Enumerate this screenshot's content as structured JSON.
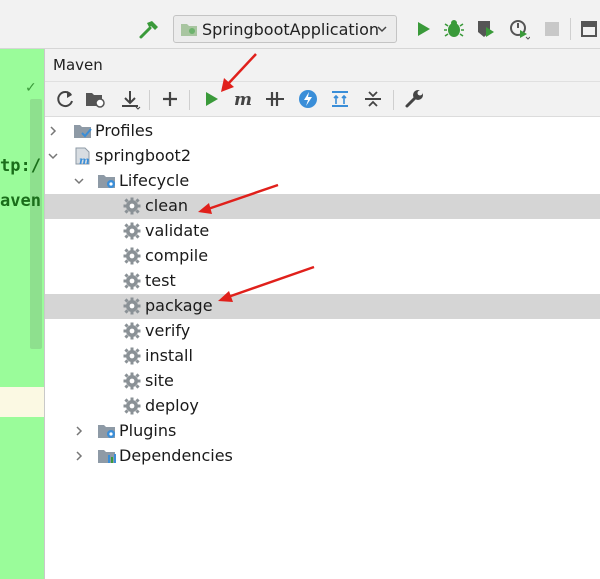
{
  "toolbar": {
    "run_config_label": "SpringbootApplication",
    "icons": [
      "hammer-icon",
      "run-config-icon",
      "chevron-down-icon",
      "run-icon",
      "debug-icon",
      "coverage-icon",
      "profile-icon",
      "stop-icon"
    ]
  },
  "editor": {
    "code_lines": [
      "tp:/",
      "aven"
    ]
  },
  "maven": {
    "title": "Maven",
    "toolbar_icons": [
      "reload-icon",
      "generate-sources-icon",
      "download-icon",
      "add-icon",
      "run-icon",
      "execute-goal-icon",
      "skip-tests-icon",
      "offline-icon",
      "show-dependencies-icon",
      "collapse-all-icon",
      "settings-icon"
    ],
    "tree": {
      "profiles": "Profiles",
      "project": "springboot2",
      "lifecycle": "Lifecycle",
      "goals": [
        "clean",
        "validate",
        "compile",
        "test",
        "package",
        "verify",
        "install",
        "site",
        "deploy"
      ],
      "plugins": "Plugins",
      "dependencies": "Dependencies"
    },
    "selected_goals": [
      "clean",
      "package"
    ]
  },
  "colors": {
    "run_green": "#3a9a3a",
    "annotation_red": "#e0201b",
    "editor_highlight": "#9afc9a",
    "selection": "#d5d5d5"
  }
}
